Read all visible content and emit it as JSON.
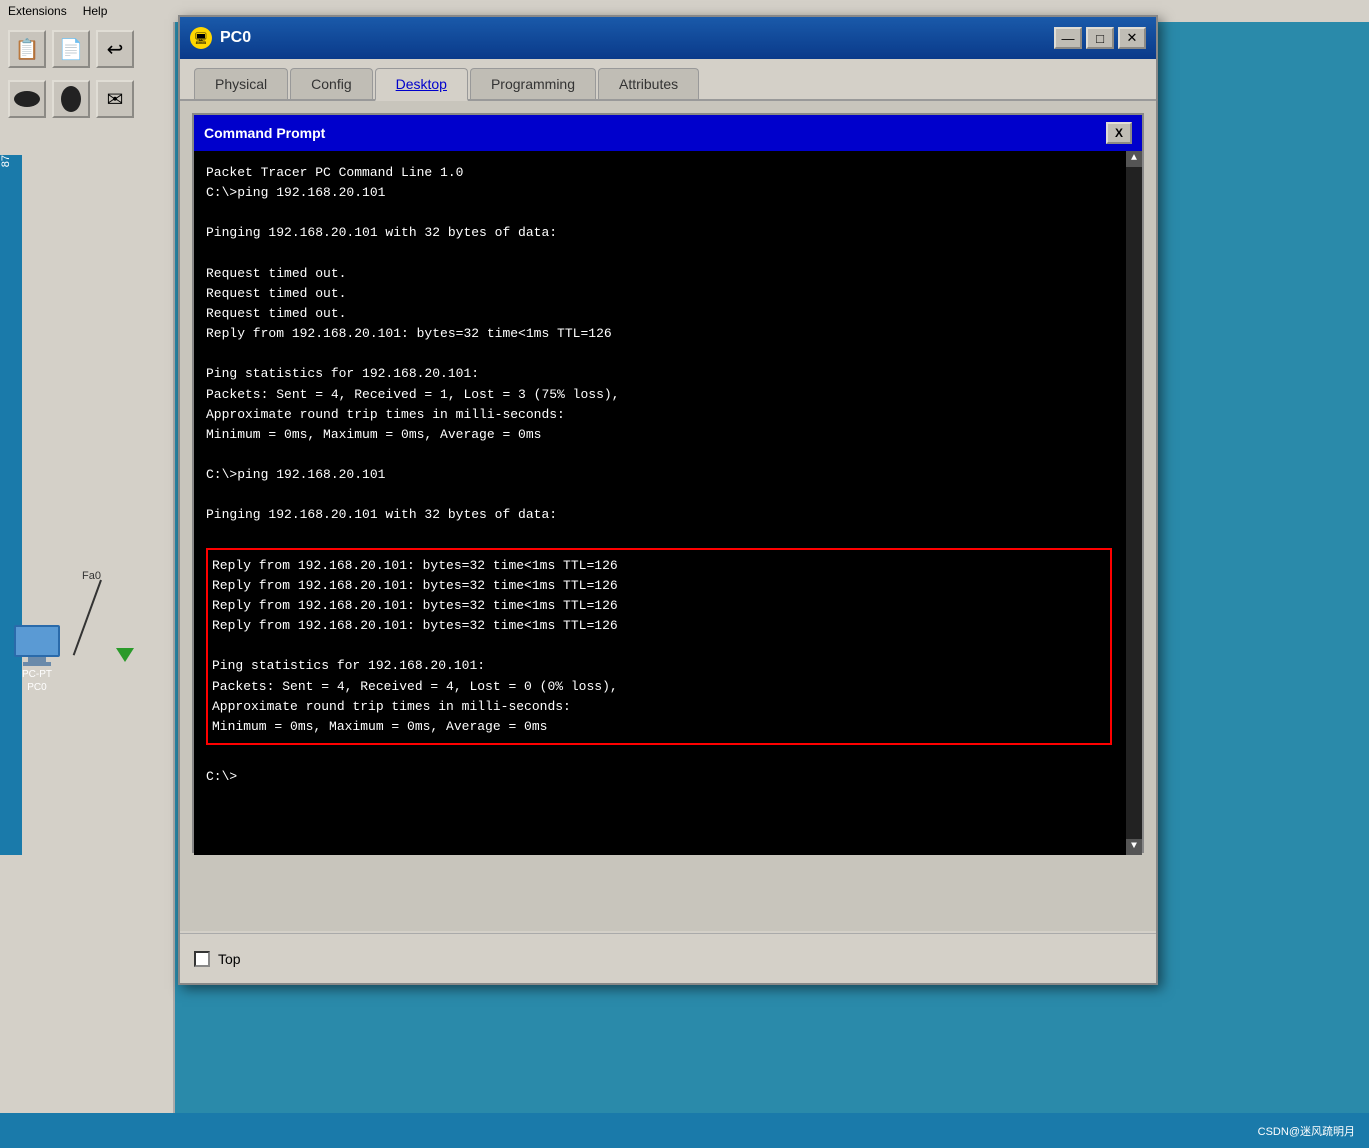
{
  "window": {
    "title": "PC0",
    "title_icon": "🖥",
    "min_btn": "—",
    "max_btn": "□",
    "close_btn": "✕"
  },
  "tabs": [
    {
      "label": "Physical",
      "active": false
    },
    {
      "label": "Config",
      "active": false
    },
    {
      "label": "Desktop",
      "active": true
    },
    {
      "label": "Programming",
      "active": false
    },
    {
      "label": "Attributes",
      "active": false
    }
  ],
  "cmd_window": {
    "title": "Command Prompt",
    "close_btn": "X"
  },
  "terminal_content": {
    "line1": "Packet Tracer PC Command Line 1.0",
    "line2": "C:\\>ping 192.168.20.101",
    "line3": "",
    "line4": "Pinging 192.168.20.101 with 32 bytes of data:",
    "line5": "",
    "line6": "Request timed out.",
    "line7": "Request timed out.",
    "line8": "Request timed out.",
    "line9": "Reply from 192.168.20.101: bytes=32 time<1ms TTL=126",
    "line10": "",
    "line11": "Ping statistics for 192.168.20.101:",
    "line12": "    Packets: Sent = 4, Received = 1, Lost = 3 (75% loss),",
    "line13": "Approximate round trip times in milli-seconds:",
    "line14": "    Minimum = 0ms, Maximum = 0ms, Average = 0ms",
    "line15": "",
    "line16": "C:\\>ping 192.168.20.101",
    "line17": "",
    "line18": "Pinging 192.168.20.101 with 32 bytes of data:",
    "line19": "",
    "highlighted_line1": "Reply from 192.168.20.101: bytes=32 time<1ms TTL=126",
    "highlighted_line2": "Reply from 192.168.20.101: bytes=32 time<1ms TTL=126",
    "highlighted_line3": "Reply from 192.168.20.101: bytes=32 time<1ms TTL=126",
    "highlighted_line4": "Reply from 192.168.20.101: bytes=32 time<1ms TTL=126",
    "highlighted_line5": "",
    "highlighted_line6": "Ping statistics for 192.168.20.101:",
    "highlighted_line7": "    Packets: Sent = 4, Received = 4, Lost = 0 (0% loss),",
    "highlighted_line8": "Approximate round trip times in milli-seconds:",
    "highlighted_line9": "    Minimum = 0ms, Maximum = 0ms, Average = 0ms",
    "prompt": "C:\\>"
  },
  "bottom": {
    "checkbox_label": "Top"
  },
  "device": {
    "label1": "PC-PT",
    "label2": "PC0",
    "port_label": "Fa0"
  },
  "status_bar": {
    "text": "CSDN@迷风疏明月"
  },
  "top_menu": {
    "item1": "Extensions",
    "item2": "Help"
  }
}
